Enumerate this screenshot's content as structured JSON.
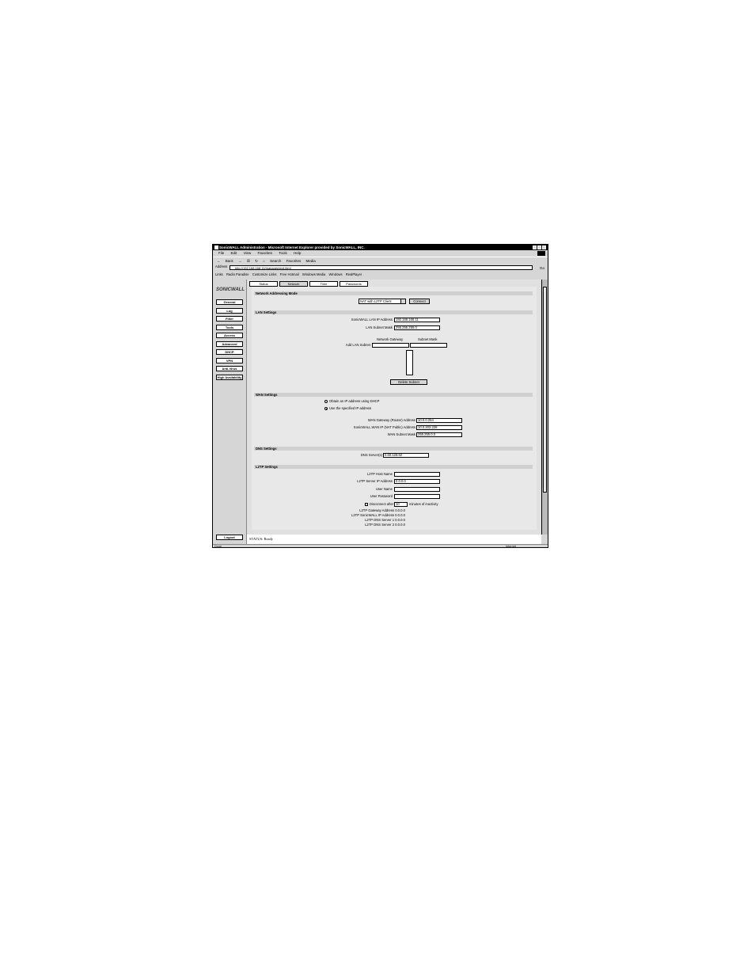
{
  "window": {
    "title": "SonicWALL Administration - Microsoft Internet Explorer provided by SonicWALL, INC."
  },
  "menu": [
    "File",
    "Edit",
    "View",
    "Favorites",
    "Tools",
    "Help"
  ],
  "toolbar": {
    "back": "Back",
    "search": "Search",
    "favorites": "Favorites",
    "media": "Media"
  },
  "address": {
    "label": "Address",
    "url": "http://192.168.168.11/management.html",
    "go": "Go"
  },
  "links": {
    "label": "Links",
    "items": [
      "Radio Paradise",
      "Customize Links",
      "Free Hotmail",
      "Windows Media",
      "Windows",
      "RealPlayer"
    ]
  },
  "sidebar": {
    "logo": "SONICWALL",
    "items": [
      "General",
      "Log",
      "Filter",
      "Tools",
      "Access",
      "Advanced",
      "DHCP",
      "VPN",
      "Anti-Virus",
      "High Availability"
    ],
    "logout": "Logout"
  },
  "tabs": [
    "Status",
    "Network",
    "Time",
    "Passwords"
  ],
  "network_mode": {
    "section": "Network Addressing Mode",
    "selected": "NAT with L2TP Client",
    "connect": "Connect"
  },
  "lan": {
    "section": "LAN Settings",
    "ip_label": "SonicWALL LAN IP Address",
    "ip_value": "192.168.168.11",
    "mask_label": "LAN Subnet Mask",
    "mask_value": "255.255.255.0",
    "gw_header": "Network Gateway",
    "mask_header": "Subnet Mask",
    "add_subnet": "Add LAN Subnet",
    "delete_subnet": "Delete Subnet"
  },
  "wan": {
    "section": "WAN Settings",
    "dhcp_option": "Obtain an IP address using DHCP",
    "static_option": "Use the specified IP address",
    "gateway_label": "WAN Gateway (Router) Address",
    "gateway_value": "10.0.0.254",
    "ip_label": "SonicWALL WAN IP (NAT Public) Address",
    "ip_value": "10.0.202.228",
    "mask_label": "WAN Subnet Mask",
    "mask_value": "255.255.0.0"
  },
  "dns": {
    "section": "DNS Settings",
    "label": "DNS Server(s)",
    "value": "0.60.128.62"
  },
  "l2tp": {
    "section": "L2TP Settings",
    "host_label": "L2TP Host Name",
    "host_value": "",
    "server_label": "L2TP Server IP Address",
    "server_value": "0.0.0.0",
    "user_label": "User Name",
    "user_value": "",
    "password_label": "User Password",
    "password_value": "",
    "disconnect_label": "Disconnect after",
    "disconnect_value": "10",
    "disconnect_suffix": "minutes of inactivity",
    "gw_addr": "L2TP Gateway Address 0.0.0.0",
    "wan_ip": "L2TP SonicWALL IP Address 0.0.0.0",
    "dns1": "L2TP DNS Server 1 0.0.0.0",
    "dns2": "L2TP DNS Server 2 0.0.0.0"
  },
  "status": {
    "text": "STATUS: Ready"
  },
  "statusbar": {
    "left": "Done",
    "zone": "Internet"
  }
}
